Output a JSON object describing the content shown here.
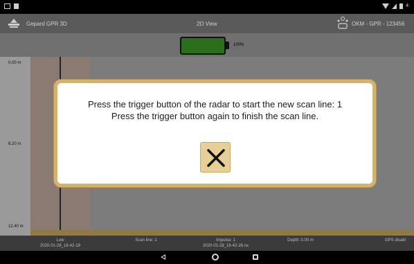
{
  "status_bar": {
    "clock": "4:"
  },
  "app_bar": {
    "app_title": "Gepard GPR 3D",
    "view_title": "2D View",
    "device_name": "OKM - GPR - 123456"
  },
  "battery": {
    "level_percent": 100,
    "label": "100%",
    "color": "#2a6f1c"
  },
  "depth_ruler": {
    "labels": [
      "0.00 m",
      "6.20 m",
      "12.40 m"
    ]
  },
  "dialog": {
    "line1": "Press the trigger button of the radar to start the new scan line: 1",
    "line2": "Press the trigger button again to finish the scan line.",
    "close_icon": "close-x-icon",
    "accent_color": "#d6b36c"
  },
  "info_bar": {
    "gain_label": "Low",
    "file_left": "2020-01-28_16-42-19",
    "scan_line": "Scan line: 1",
    "impulse": "Impulse: 1",
    "file_right": "2020-01-28_16-42-26.nx",
    "depth": "Depth: 0.00 m",
    "gps": "GPS disabl"
  },
  "nav_bar": {
    "back_icon": "back-icon",
    "home_icon": "home-icon",
    "recents_icon": "recents-icon"
  }
}
